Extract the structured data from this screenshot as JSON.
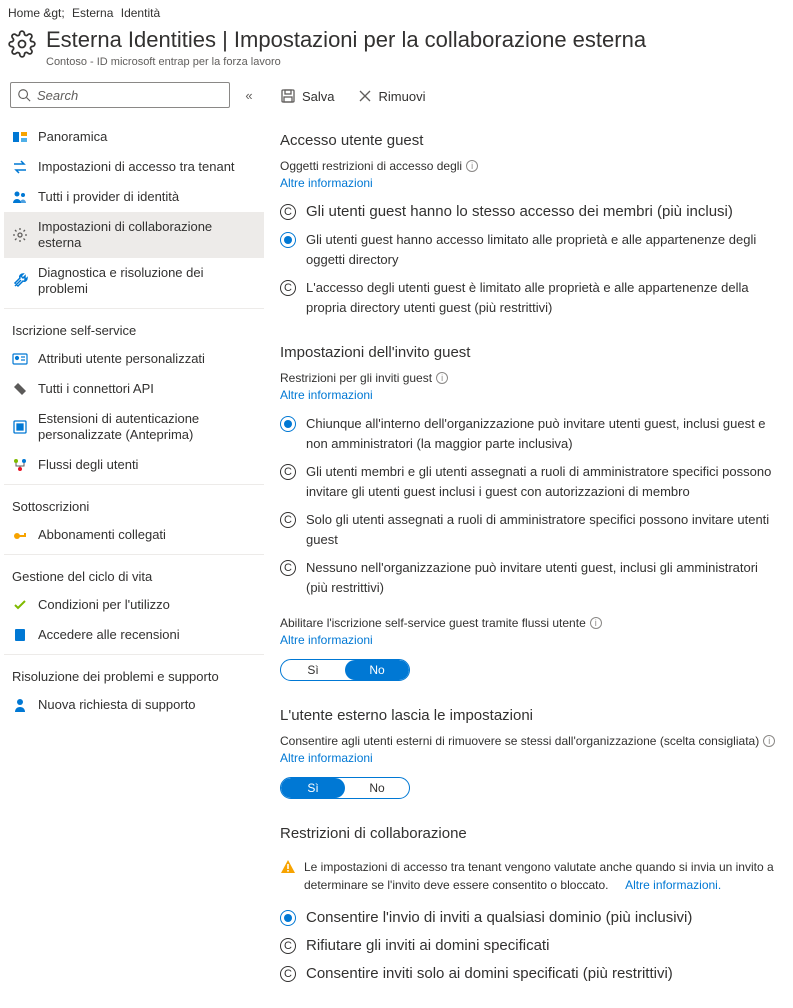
{
  "breadcrumb": {
    "home": "Home &gt;",
    "ext": "Esterna",
    "id": "Identità"
  },
  "header": {
    "title": "Esterna    Identities | Impostazioni per la collaborazione esterna",
    "subtitle": "Contoso - ID microsoft entrap per la forza lavoro"
  },
  "search": {
    "placeholder": "Search"
  },
  "nav": {
    "items": [
      {
        "label": "Panoramica"
      },
      {
        "label": "Impostazioni di accesso tra tenant"
      },
      {
        "label": "Tutti i provider di identità"
      },
      {
        "label": "Impostazioni di collaborazione esterna"
      },
      {
        "label": "Diagnostica e risoluzione dei problemi"
      }
    ],
    "section_selfservice": "Iscrizione self-service",
    "selfservice": [
      {
        "label": "Attributi utente personalizzati"
      },
      {
        "label": "Tutti i connettori API"
      },
      {
        "label": "Estensioni di autenticazione personalizzate (Anteprima)"
      },
      {
        "label": "Flussi degli utenti"
      }
    ],
    "section_subscriptions": "Sottoscrizioni",
    "subscriptions": [
      {
        "label": "Abbonamenti collegati"
      }
    ],
    "section_lifecycle": "Gestione del ciclo di vita",
    "lifecycle": [
      {
        "label": "Condizioni per l'utilizzo"
      },
      {
        "label": "Accedere alle recensioni"
      }
    ],
    "section_support": "Risoluzione dei problemi e supporto",
    "support": [
      {
        "label": "Nuova richiesta di supporto"
      }
    ]
  },
  "toolbar": {
    "save": "Salva",
    "discard": "Rimuovi"
  },
  "guest_access": {
    "title": "Accesso utente guest",
    "label": "Oggetti restrizioni di accesso degli",
    "learn": "Altre informazioni",
    "opt1": "Gli utenti guest hanno lo stesso accesso dei membri (più inclusi)",
    "opt2": "Gli utenti guest hanno accesso limitato alle proprietà e alle appartenenze degli oggetti directory",
    "opt3": "L'accesso degli utenti guest è limitato alle proprietà e alle appartenenze della propria directory utenti guest (più restrittivi)"
  },
  "guest_invite": {
    "title": "Impostazioni dell'invito guest",
    "label": "Restrizioni per gli inviti guest",
    "learn": "Altre informazioni",
    "opt1": "Chiunque all'interno dell'organizzazione può invitare utenti guest, inclusi guest e non amministratori (la maggior parte inclusiva)",
    "opt2": "Gli utenti membri e gli utenti assegnati a ruoli di amministratore specifici possono invitare gli utenti guest inclusi i guest con autorizzazioni di membro",
    "opt3": "Solo gli utenti assegnati a ruoli di amministratore specifici possono invitare utenti guest",
    "opt4": "Nessuno nell'organizzazione può invitare utenti guest, inclusi gli amministratori (più restrittivi)"
  },
  "self_signup": {
    "label": "Abilitare l'iscrizione self-service guest tramite flussi utente",
    "learn": "Altre informazioni",
    "yes": "Sì",
    "no": "No"
  },
  "external_leave": {
    "title": "L'utente esterno lascia le impostazioni",
    "label": "Consentire agli utenti esterni di rimuovere se stessi dall'organizzazione (scelta consigliata)",
    "learn": "Altre informazioni",
    "yes": "Sì",
    "no": "No"
  },
  "collab": {
    "title": "Restrizioni di collaborazione",
    "warning": "Le impostazioni di accesso tra tenant vengono valutate anche quando si invia un invito a determinare se l'invito deve essere consentito o bloccato.",
    "warning_link": "Altre informazioni.",
    "opt1": "Consentire l'invio di inviti a qualsiasi dominio (più inclusivi)",
    "opt2": "Rifiutare gli inviti ai domini specificati",
    "opt3": "Consentire inviti solo ai domini specificati (più restrittivi)"
  }
}
